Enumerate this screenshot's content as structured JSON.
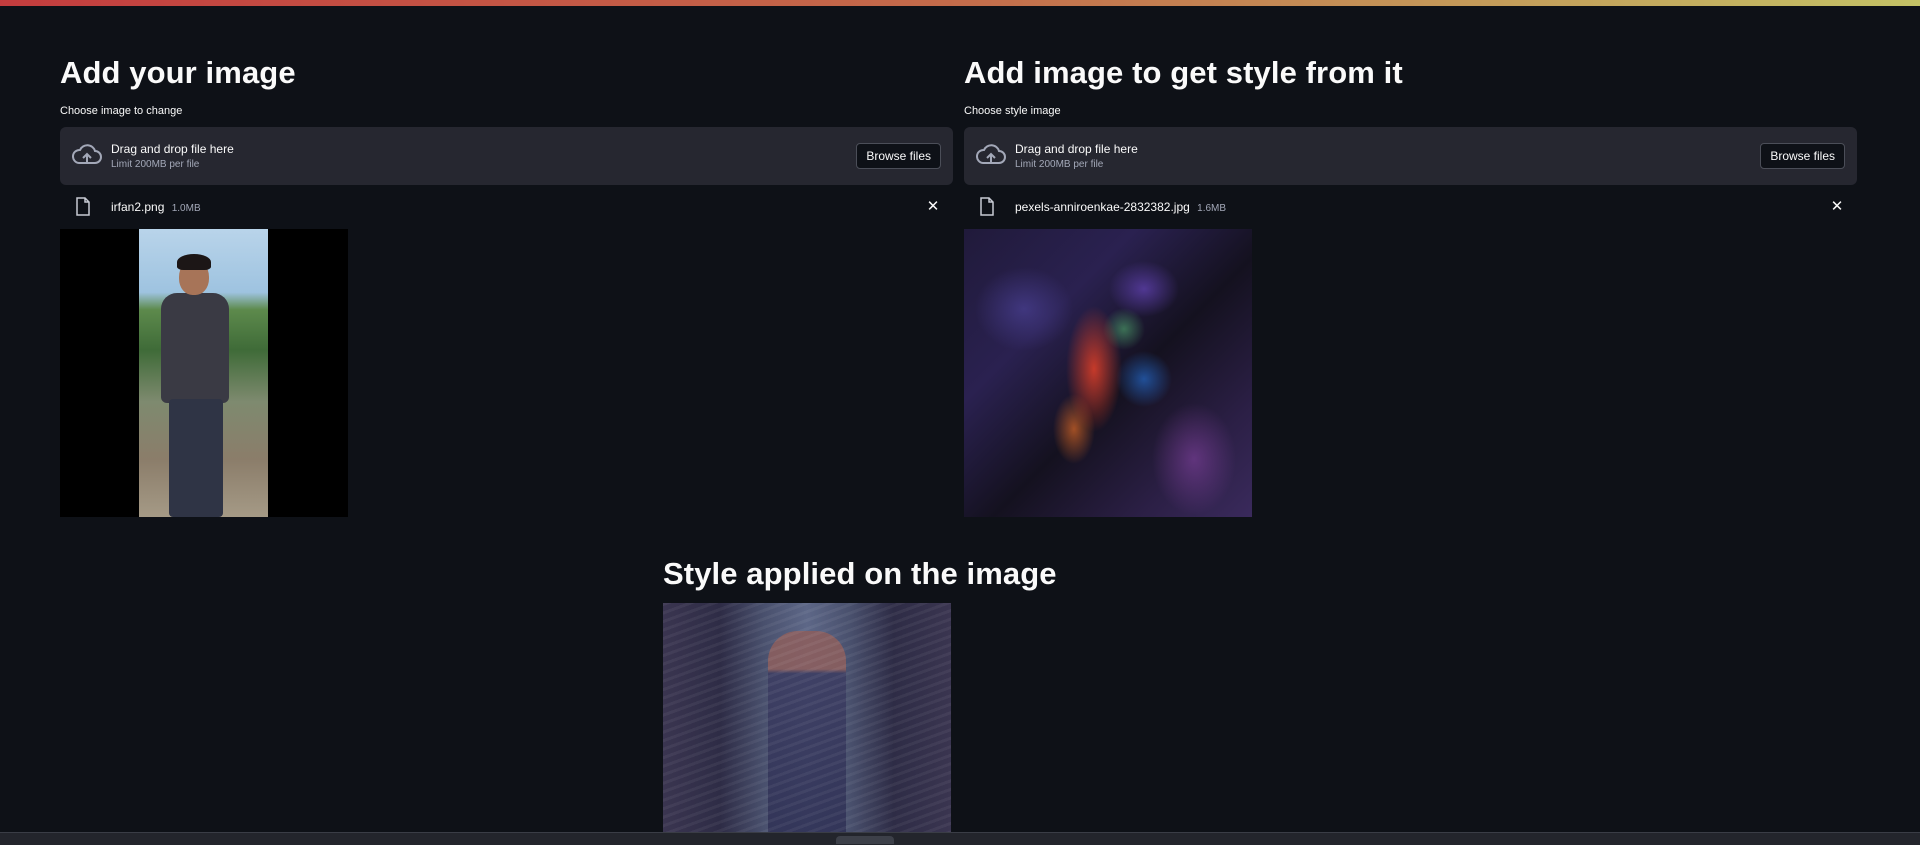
{
  "left": {
    "heading": "Add your image",
    "uploader_label": "Choose image to change",
    "dropzone": {
      "main_text": "Drag and drop file here",
      "sub_text": "Limit 200MB per file",
      "browse_label": "Browse files"
    },
    "file": {
      "name": "irfan2.png",
      "size": "1.0MB"
    },
    "close_glyph": "✕"
  },
  "right": {
    "heading": "Add image to get style from it",
    "uploader_label": "Choose style image",
    "dropzone": {
      "main_text": "Drag and drop file here",
      "sub_text": "Limit 200MB per file",
      "browse_label": "Browse files"
    },
    "file": {
      "name": "pexels-anniroenkae-2832382.jpg",
      "size": "1.6MB"
    },
    "close_glyph": "✕"
  },
  "result": {
    "heading": "Style applied on the image"
  },
  "theme": {
    "background": "#0e1117",
    "dropzone_bg": "#262730",
    "text": "#fafafa",
    "muted_text": "#a3a8b8"
  }
}
